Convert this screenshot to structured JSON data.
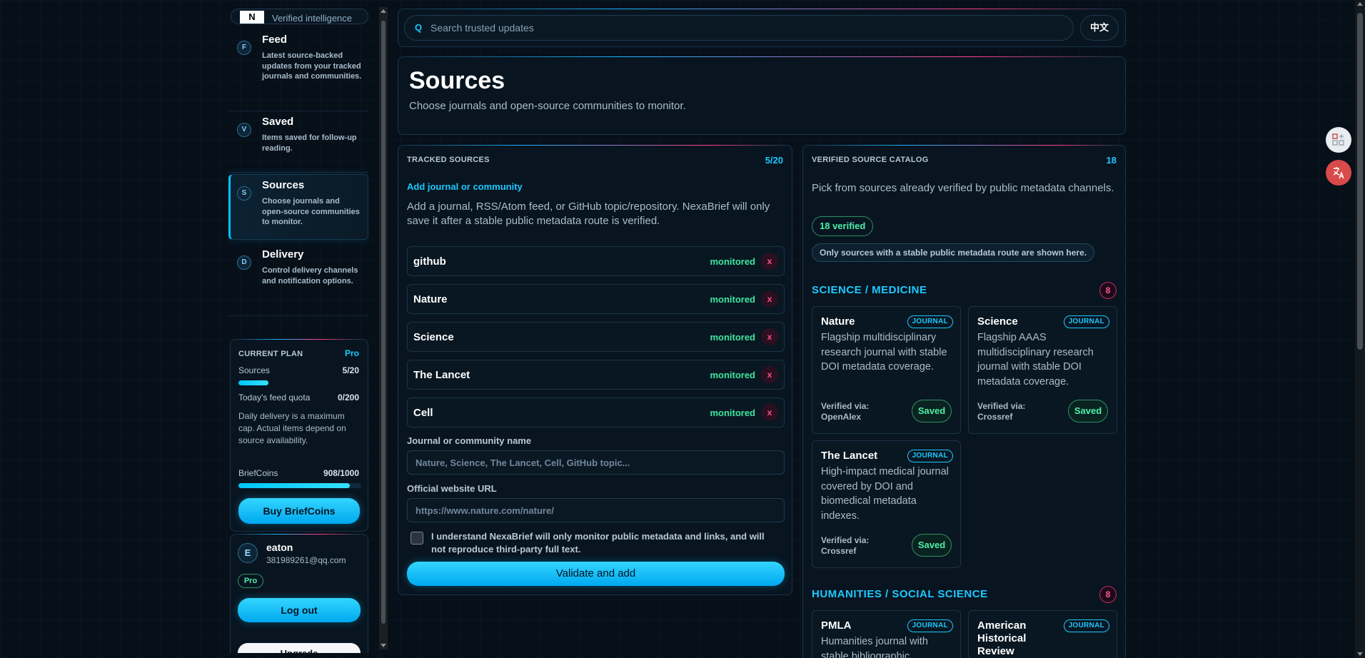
{
  "brand": {
    "logo": "N",
    "tagline": "Verified intelligence"
  },
  "nav": [
    {
      "badge": "F",
      "title": "Feed",
      "desc": "Latest source-backed updates from your tracked journals and communities."
    },
    {
      "badge": "V",
      "title": "Saved",
      "desc": "Items saved for follow-up reading."
    },
    {
      "badge": "S",
      "title": "Sources",
      "desc": "Choose journals and open-source communities to monitor.",
      "active": true
    },
    {
      "badge": "D",
      "title": "Delivery",
      "desc": "Control delivery channels and notification options."
    }
  ],
  "plan": {
    "title": "CURRENT PLAN",
    "tier": "Pro",
    "sources_label": "Sources",
    "sources_value": "5/20",
    "sources_fill": 0.25,
    "quota_label": "Today's feed quota",
    "quota_value": "0/200",
    "note": "Daily delivery is a maximum cap. Actual items depend on source availability.",
    "coins_label": "BriefCoins",
    "coins_value": "908/1000",
    "coins_fill": 0.908,
    "buy_label": "Buy BriefCoins"
  },
  "user": {
    "initial": "E",
    "name": "eaton",
    "email": "381989261@qq.com",
    "tier": "Pro",
    "logout_label": "Log out",
    "upgrade_label": "Upgrade"
  },
  "search": {
    "placeholder": "Search trusted updates",
    "icon_glyph": "Q",
    "lang_label": "中文"
  },
  "header": {
    "title": "Sources",
    "subtitle": "Choose journals and open-source communities to monitor."
  },
  "tracked": {
    "label": "TRACKED SOURCES",
    "count": "5/20",
    "add_link": "Add journal or community",
    "help": "Add a journal, RSS/Atom feed, or GitHub topic/repository. NexaBrief will only save it after a stable public metadata route is verified.",
    "items": [
      {
        "name": "github",
        "status": "monitored",
        "remove": "x"
      },
      {
        "name": "Nature",
        "status": "monitored",
        "remove": "x"
      },
      {
        "name": "Science",
        "status": "monitored",
        "remove": "x"
      },
      {
        "name": "The Lancet",
        "status": "monitored",
        "remove": "x"
      },
      {
        "name": "Cell",
        "status": "monitored",
        "remove": "x"
      }
    ],
    "name_label": "Journal or community name",
    "name_placeholder": "Nature, Science, The Lancet, Cell, GitHub topic...",
    "url_label": "Official website URL",
    "url_placeholder": "https://www.nature.com/nature/",
    "consent": "I understand NexaBrief will only monitor public metadata and links, and will not reproduce third-party full text.",
    "submit_label": "Validate and add"
  },
  "catalog": {
    "label": "VERIFIED SOURCE CATALOG",
    "count": "18",
    "intro": "Pick from sources already verified by public metadata channels.",
    "verified_pill": "18 verified",
    "info_pill": "Only sources with a stable public metadata route are shown here.",
    "sections": [
      {
        "title": "SCIENCE / MEDICINE",
        "count": "8",
        "cards": [
          {
            "name": "Nature",
            "tag": "JOURNAL",
            "desc": "Flagship multidisciplinary research journal with stable DOI metadata coverage.",
            "verified": "Verified via: OpenAlex",
            "action": "Saved"
          },
          {
            "name": "Science",
            "tag": "JOURNAL",
            "desc": "Flagship AAAS multidisciplinary research journal with stable DOI metadata coverage.",
            "verified": "Verified via: Crossref",
            "action": "Saved"
          },
          {
            "name": "The Lancet",
            "tag": "JOURNAL",
            "desc": "High-impact medical journal covered by DOI and biomedical metadata indexes.",
            "verified": "Verified via: Crossref",
            "action": "Saved"
          }
        ]
      },
      {
        "title": "HUMANITIES / SOCIAL SCIENCE",
        "count": "8",
        "cards": [
          {
            "name": "PMLA",
            "tag": "JOURNAL",
            "desc": "Humanities journal with stable bibliographic"
          },
          {
            "name": "American Historical Review",
            "tag": "JOURNAL",
            "desc": ""
          }
        ]
      }
    ]
  },
  "icons": {
    "float_top": "grid-plus-icon",
    "float_bottom": "translate-icon"
  },
  "colors": {
    "accent": "#1ec8ff",
    "success": "#3ee6a0",
    "danger": "#ff4f8f",
    "background": "#071019"
  }
}
